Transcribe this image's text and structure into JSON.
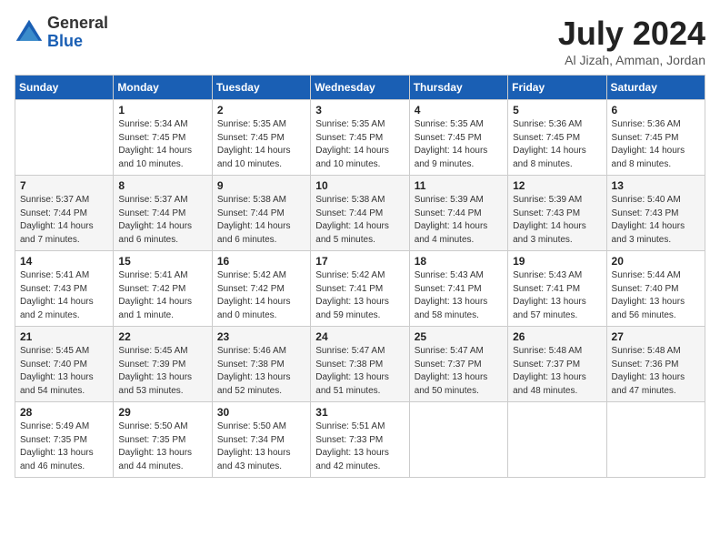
{
  "header": {
    "logo_general": "General",
    "logo_blue": "Blue",
    "month_title": "July 2024",
    "location": "Al Jizah, Amman, Jordan"
  },
  "days_of_week": [
    "Sunday",
    "Monday",
    "Tuesday",
    "Wednesday",
    "Thursday",
    "Friday",
    "Saturday"
  ],
  "weeks": [
    [
      {
        "day": "",
        "sunrise": "",
        "sunset": "",
        "daylight": ""
      },
      {
        "day": "1",
        "sunrise": "Sunrise: 5:34 AM",
        "sunset": "Sunset: 7:45 PM",
        "daylight": "Daylight: 14 hours and 10 minutes."
      },
      {
        "day": "2",
        "sunrise": "Sunrise: 5:35 AM",
        "sunset": "Sunset: 7:45 PM",
        "daylight": "Daylight: 14 hours and 10 minutes."
      },
      {
        "day": "3",
        "sunrise": "Sunrise: 5:35 AM",
        "sunset": "Sunset: 7:45 PM",
        "daylight": "Daylight: 14 hours and 10 minutes."
      },
      {
        "day": "4",
        "sunrise": "Sunrise: 5:35 AM",
        "sunset": "Sunset: 7:45 PM",
        "daylight": "Daylight: 14 hours and 9 minutes."
      },
      {
        "day": "5",
        "sunrise": "Sunrise: 5:36 AM",
        "sunset": "Sunset: 7:45 PM",
        "daylight": "Daylight: 14 hours and 8 minutes."
      },
      {
        "day": "6",
        "sunrise": "Sunrise: 5:36 AM",
        "sunset": "Sunset: 7:45 PM",
        "daylight": "Daylight: 14 hours and 8 minutes."
      }
    ],
    [
      {
        "day": "7",
        "sunrise": "Sunrise: 5:37 AM",
        "sunset": "Sunset: 7:44 PM",
        "daylight": "Daylight: 14 hours and 7 minutes."
      },
      {
        "day": "8",
        "sunrise": "Sunrise: 5:37 AM",
        "sunset": "Sunset: 7:44 PM",
        "daylight": "Daylight: 14 hours and 6 minutes."
      },
      {
        "day": "9",
        "sunrise": "Sunrise: 5:38 AM",
        "sunset": "Sunset: 7:44 PM",
        "daylight": "Daylight: 14 hours and 6 minutes."
      },
      {
        "day": "10",
        "sunrise": "Sunrise: 5:38 AM",
        "sunset": "Sunset: 7:44 PM",
        "daylight": "Daylight: 14 hours and 5 minutes."
      },
      {
        "day": "11",
        "sunrise": "Sunrise: 5:39 AM",
        "sunset": "Sunset: 7:44 PM",
        "daylight": "Daylight: 14 hours and 4 minutes."
      },
      {
        "day": "12",
        "sunrise": "Sunrise: 5:39 AM",
        "sunset": "Sunset: 7:43 PM",
        "daylight": "Daylight: 14 hours and 3 minutes."
      },
      {
        "day": "13",
        "sunrise": "Sunrise: 5:40 AM",
        "sunset": "Sunset: 7:43 PM",
        "daylight": "Daylight: 14 hours and 3 minutes."
      }
    ],
    [
      {
        "day": "14",
        "sunrise": "Sunrise: 5:41 AM",
        "sunset": "Sunset: 7:43 PM",
        "daylight": "Daylight: 14 hours and 2 minutes."
      },
      {
        "day": "15",
        "sunrise": "Sunrise: 5:41 AM",
        "sunset": "Sunset: 7:42 PM",
        "daylight": "Daylight: 14 hours and 1 minute."
      },
      {
        "day": "16",
        "sunrise": "Sunrise: 5:42 AM",
        "sunset": "Sunset: 7:42 PM",
        "daylight": "Daylight: 14 hours and 0 minutes."
      },
      {
        "day": "17",
        "sunrise": "Sunrise: 5:42 AM",
        "sunset": "Sunset: 7:41 PM",
        "daylight": "Daylight: 13 hours and 59 minutes."
      },
      {
        "day": "18",
        "sunrise": "Sunrise: 5:43 AM",
        "sunset": "Sunset: 7:41 PM",
        "daylight": "Daylight: 13 hours and 58 minutes."
      },
      {
        "day": "19",
        "sunrise": "Sunrise: 5:43 AM",
        "sunset": "Sunset: 7:41 PM",
        "daylight": "Daylight: 13 hours and 57 minutes."
      },
      {
        "day": "20",
        "sunrise": "Sunrise: 5:44 AM",
        "sunset": "Sunset: 7:40 PM",
        "daylight": "Daylight: 13 hours and 56 minutes."
      }
    ],
    [
      {
        "day": "21",
        "sunrise": "Sunrise: 5:45 AM",
        "sunset": "Sunset: 7:40 PM",
        "daylight": "Daylight: 13 hours and 54 minutes."
      },
      {
        "day": "22",
        "sunrise": "Sunrise: 5:45 AM",
        "sunset": "Sunset: 7:39 PM",
        "daylight": "Daylight: 13 hours and 53 minutes."
      },
      {
        "day": "23",
        "sunrise": "Sunrise: 5:46 AM",
        "sunset": "Sunset: 7:38 PM",
        "daylight": "Daylight: 13 hours and 52 minutes."
      },
      {
        "day": "24",
        "sunrise": "Sunrise: 5:47 AM",
        "sunset": "Sunset: 7:38 PM",
        "daylight": "Daylight: 13 hours and 51 minutes."
      },
      {
        "day": "25",
        "sunrise": "Sunrise: 5:47 AM",
        "sunset": "Sunset: 7:37 PM",
        "daylight": "Daylight: 13 hours and 50 minutes."
      },
      {
        "day": "26",
        "sunrise": "Sunrise: 5:48 AM",
        "sunset": "Sunset: 7:37 PM",
        "daylight": "Daylight: 13 hours and 48 minutes."
      },
      {
        "day": "27",
        "sunrise": "Sunrise: 5:48 AM",
        "sunset": "Sunset: 7:36 PM",
        "daylight": "Daylight: 13 hours and 47 minutes."
      }
    ],
    [
      {
        "day": "28",
        "sunrise": "Sunrise: 5:49 AM",
        "sunset": "Sunset: 7:35 PM",
        "daylight": "Daylight: 13 hours and 46 minutes."
      },
      {
        "day": "29",
        "sunrise": "Sunrise: 5:50 AM",
        "sunset": "Sunset: 7:35 PM",
        "daylight": "Daylight: 13 hours and 44 minutes."
      },
      {
        "day": "30",
        "sunrise": "Sunrise: 5:50 AM",
        "sunset": "Sunset: 7:34 PM",
        "daylight": "Daylight: 13 hours and 43 minutes."
      },
      {
        "day": "31",
        "sunrise": "Sunrise: 5:51 AM",
        "sunset": "Sunset: 7:33 PM",
        "daylight": "Daylight: 13 hours and 42 minutes."
      },
      {
        "day": "",
        "sunrise": "",
        "sunset": "",
        "daylight": ""
      },
      {
        "day": "",
        "sunrise": "",
        "sunset": "",
        "daylight": ""
      },
      {
        "day": "",
        "sunrise": "",
        "sunset": "",
        "daylight": ""
      }
    ]
  ]
}
